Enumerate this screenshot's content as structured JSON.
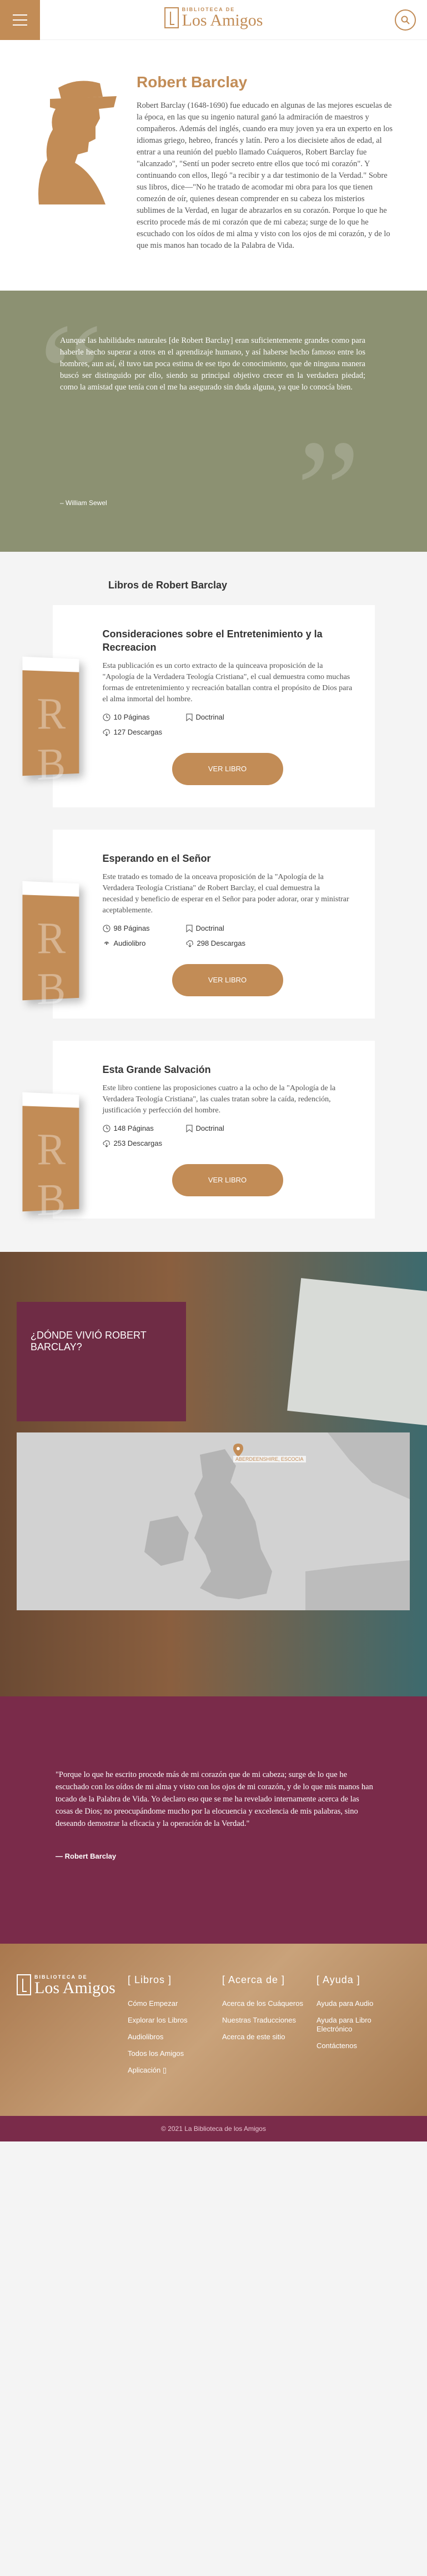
{
  "header": {
    "logo_top": "BIBLIOTECA DE",
    "logo_bottom": "Los Amigos"
  },
  "author": {
    "name": "Robert Barclay",
    "bio": "Robert Barclay (1648-1690) fue educado en algunas de las mejores escuelas de la época, en las que su ingenio natural ganó la admiración de maestros y compañeros. Además del inglés, cuando era muy joven ya era un experto en los idiomas griego, hebreo, francés y latín. Pero a los diecisiete años de edad, al entrar a una reunión del pueblo llamado Cuáqueros, Robert Barclay fue \"alcanzado\", \"Sentí un poder secreto entre ellos que tocó mi corazón\". Y continuando con ellos, llegó \"a recibir y a dar testimonio de la Verdad.\" Sobre sus libros, dice—\"No he tratado de acomodar mi obra para los que tienen comezón de oír, quienes desean comprender en su cabeza los misterios sublimes de la Verdad, en lugar de abrazarlos en su corazón. Porque lo que he escrito procede más de mi corazón que de mi cabeza; surge de lo que he escuchado con los oídos de mi alma y visto con los ojos de mi corazón, y de lo que mis manos han tocado de la Palabra de Vida."
  },
  "quote": {
    "text": "Aunque las habilidades naturales [de Robert Barclay] eran suficientemente grandes como para haberle hecho superar a otros en el aprendizaje humano, y así haberse hecho famoso entre los hombres, aun así, él tuvo tan poca estima de ese tipo de conocimiento, que de ninguna manera buscó ser distinguido por ello, siendo su principal objetivo crecer en la verdadera piedad; como la amistad que tenía con el me ha asegurado sin duda alguna, ya que lo conocía bien.",
    "author": "– William Sewel"
  },
  "books": {
    "section_title": "Libros de Robert Barclay",
    "items": [
      {
        "title": "Consideraciones sobre el Entretenimiento y la Recreacion",
        "desc": "Esta publicación es un corto extracto de la quinceava proposición de la \"Apología de la Verdadera Teología Cristiana\", el cual demuestra como muchas formas de entretenimiento y recreación batallan contra el propósito de Dios para el alma inmortal del hombre.",
        "pages": "10 Páginas",
        "category": "Doctrinal",
        "downloads": "127 Descargas",
        "button": "VER LIBRO"
      },
      {
        "title": "Esperando en el Señor",
        "desc": "Este tratado es tomado de la onceava proposición de la \"Apología de la Verdadera Teología Cristiana\" de Robert Barclay, el cual demuestra la necesidad y beneficio de esperar en el Señor para poder adorar, orar y ministrar aceptablemente.",
        "pages": "98 Páginas",
        "category": "Doctrinal",
        "audio": "Audiolibro",
        "downloads": "298 Descargas",
        "button": "VER LIBRO"
      },
      {
        "title": "Esta Grande Salvación",
        "desc": "Este libro contiene las proposiciones cuatro a la ocho de la \"Apología de la Verdadera Teología Cristiana\", las cuales tratan sobre la caída, redención, justificación y perfección del hombre.",
        "pages": "148 Páginas",
        "category": "Doctrinal",
        "downloads": "253 Descargas",
        "button": "VER LIBRO"
      }
    ]
  },
  "where": {
    "title": "¿DÓNDE VIVIÓ ROBERT BARCLAY?",
    "map_label": "ABERDEENSHIRE, ESCOCIA"
  },
  "closing": {
    "text": "\"Porque lo que he escrito procede más de mi corazón que de mi cabeza; surge de lo que he escuchado con los oídos de mi alma y visto con los ojos de mi corazón, y de lo que mis manos han tocado de la Palabra de Vida. Yo declaro eso que se me ha revelado internamente acerca de las cosas de Dios; no preocupándome mucho por la elocuencia y excelencia de mis palabras, sino deseando demostrar la eficacia y la operación de la Verdad.\"",
    "author": "— Robert Barclay"
  },
  "footer": {
    "libros": {
      "title": "[ Libros ]",
      "links": [
        "Cómo Empezar",
        "Explorar los Libros",
        "Audiolibros",
        "Todos los Amigos",
        "Aplicación"
      ]
    },
    "acerca": {
      "title": "[ Acerca de ]",
      "links": [
        "Acerca de los Cuáqueros",
        "Nuestras Traducciones",
        "Acerca de este sitio"
      ]
    },
    "ayuda": {
      "title": "[ Ayuda ]",
      "links": [
        "Ayuda para Audio",
        "Ayuda para Libro Electrónico",
        "Contáctenos"
      ]
    },
    "copyright": "© 2021 La Biblioteca de los Amigos"
  }
}
